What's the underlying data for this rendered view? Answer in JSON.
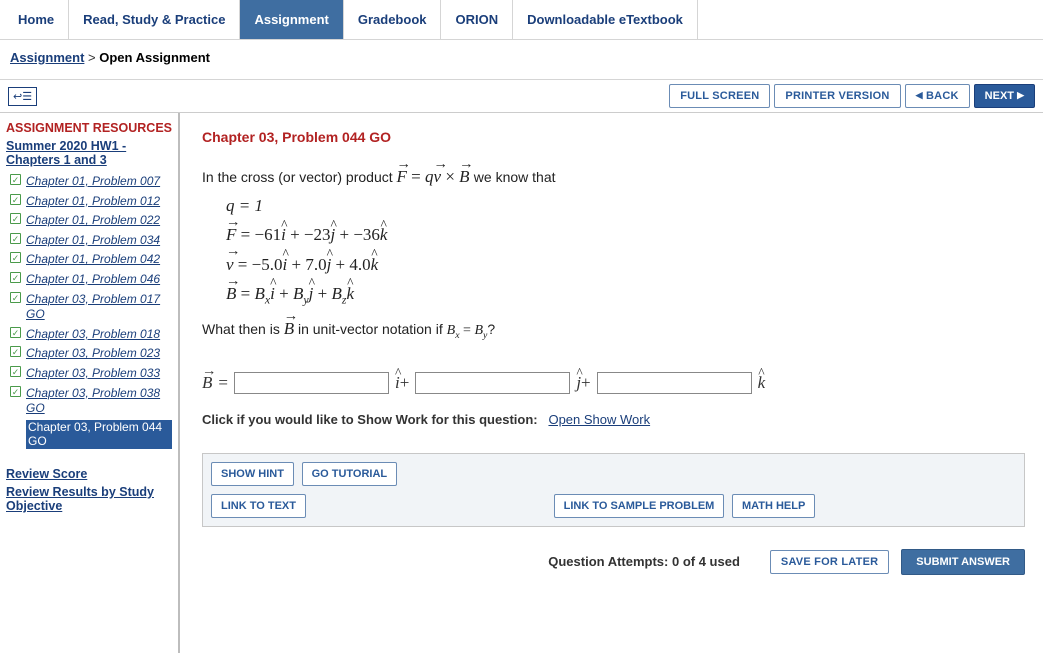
{
  "nav": {
    "home": "Home",
    "read": "Read, Study & Practice",
    "assignment": "Assignment",
    "gradebook": "Gradebook",
    "orion": "ORION",
    "etext": "Downloadable eTextbook"
  },
  "breadcrumb": {
    "parent": "Assignment",
    "sep": " > ",
    "current": "Open Assignment"
  },
  "toolbar": {
    "fullscreen": "FULL SCREEN",
    "printer": "PRINTER VERSION",
    "back": "BACK",
    "next": "NEXT"
  },
  "sidebar": {
    "heading": "ASSIGNMENT RESOURCES",
    "set_title": "Summer 2020 HW1 - Chapters 1 and 3",
    "items": [
      {
        "label": "Chapter 01, Problem 007"
      },
      {
        "label": "Chapter 01, Problem 012"
      },
      {
        "label": "Chapter 01, Problem 022"
      },
      {
        "label": "Chapter 01, Problem 034"
      },
      {
        "label": "Chapter 01, Problem 042"
      },
      {
        "label": "Chapter 01, Problem 046"
      },
      {
        "label": "Chapter 03, Problem 017 GO"
      },
      {
        "label": "Chapter 03, Problem 018"
      },
      {
        "label": "Chapter 03, Problem 023"
      },
      {
        "label": "Chapter 03, Problem 033"
      },
      {
        "label": "Chapter 03, Problem 038 GO"
      },
      {
        "label": "Chapter 03, Problem 044 GO"
      }
    ],
    "review_score": "Review Score",
    "review_results": "Review Results by Study Objective"
  },
  "problem": {
    "title": "Chapter 03, Problem 044 GO",
    "intro_pre": "In the cross (or vector) product ",
    "intro_post": " we know that",
    "q_val": "q = 1",
    "what_then": "What then is ",
    "what_then_post": " in unit-vector notation if ",
    "bx_eq_by": "Bx = By",
    "qmark": "?",
    "F_coeff_i": "−61",
    "F_coeff_j": "−23",
    "F_coeff_k": "−36",
    "v_coeff_i": "−5.0",
    "v_coeff_j": "7.0",
    "v_coeff_k": "4.0"
  },
  "answer": {
    "eq": " ="
  },
  "show_work": {
    "label": "Click if you would like to Show Work for this question:",
    "link": "Open Show Work"
  },
  "help": {
    "show_hint": "SHOW HINT",
    "go_tutorial": "GO TUTORIAL",
    "link_to_text": "LINK TO TEXT",
    "link_to_sample": "LINK TO SAMPLE PROBLEM",
    "math_help": "MATH HELP"
  },
  "footer": {
    "attempts": "Question Attempts: 0 of 4 used",
    "save": "SAVE FOR LATER",
    "submit": "SUBMIT ANSWER"
  }
}
